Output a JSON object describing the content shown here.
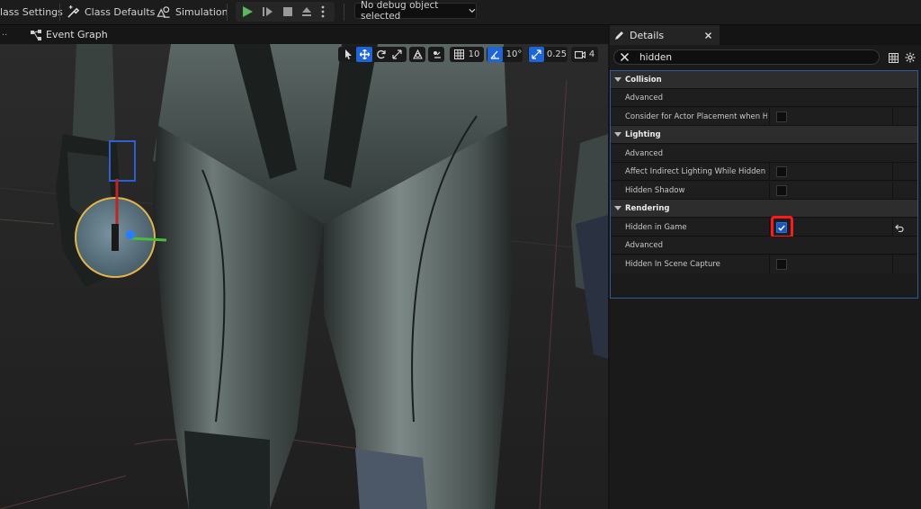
{
  "toolbar": {
    "class_settings": "lass Settings",
    "class_defaults": "Class Defaults",
    "simulation": "Simulation",
    "debug_object": "No debug object selected"
  },
  "tabs": {
    "event_graph": "Event Graph",
    "details": "Details"
  },
  "viewport": {
    "grid_snap": "10",
    "rotation_snap": "10°",
    "scale_snap": "0.25",
    "camera_speed": "4"
  },
  "details": {
    "search_value": "hidden",
    "sections": [
      {
        "title": "Collision",
        "advanced": "Advanced",
        "props": [
          {
            "label": "Consider for Actor Placement when Hid...",
            "checked": false
          }
        ]
      },
      {
        "title": "Lighting",
        "advanced": "Advanced",
        "props": [
          {
            "label": "Affect Indirect Lighting While Hidden",
            "checked": false
          },
          {
            "label": "Hidden Shadow",
            "checked": false
          }
        ]
      },
      {
        "title": "Rendering",
        "props_top": [
          {
            "label": "Hidden in Game",
            "checked": true
          }
        ],
        "advanced": "Advanced",
        "props_bottom": [
          {
            "label": "Hidden In Scene Capture",
            "checked": false
          }
        ]
      }
    ]
  },
  "colors": {
    "accent_blue": "#1f65d6",
    "play_green": "#5cb85c",
    "highlight_red": "#ff1a1a"
  }
}
